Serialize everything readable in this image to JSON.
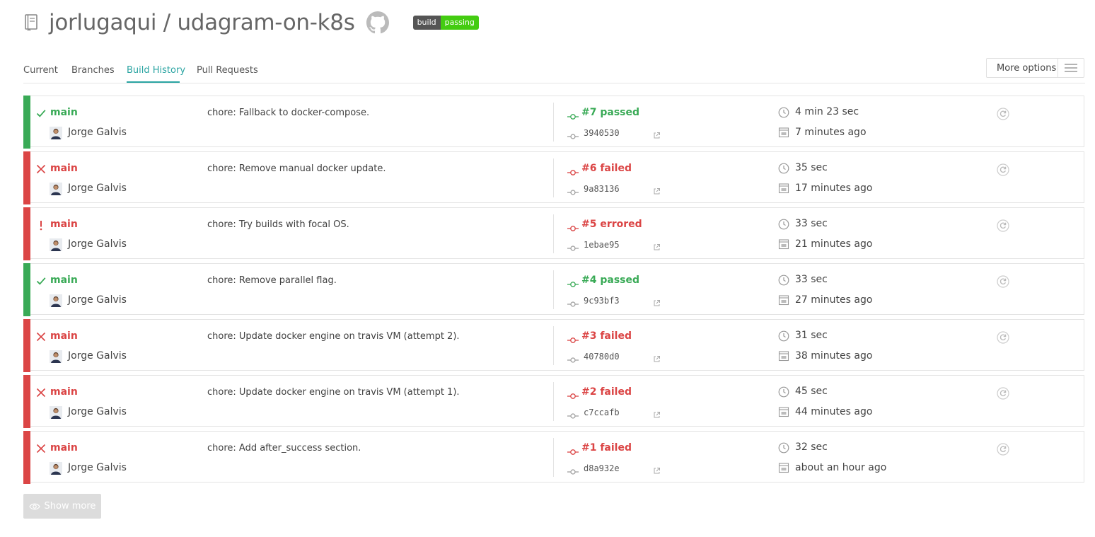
{
  "repo": {
    "title": "jorlugaqui / udagram-on-k8s",
    "badge_left": "build",
    "badge_right": "passing"
  },
  "tabs": [
    {
      "label": "Current"
    },
    {
      "label": "Branches"
    },
    {
      "label": "Build History",
      "active": true
    },
    {
      "label": "Pull Requests"
    }
  ],
  "more_options": {
    "label": "More options"
  },
  "colors": {
    "passed": "#39aa56",
    "failed": "#db4545",
    "accent": "#2aa4a2"
  },
  "builds": [
    {
      "state": "passed",
      "branch": "main",
      "author": "Jorge Galvis",
      "message": "chore: Fallback to docker-compose.",
      "number": "#7 passed",
      "sha": "3940530",
      "duration": "4 min 23 sec",
      "finished": "7 minutes ago"
    },
    {
      "state": "failed",
      "branch": "main",
      "author": "Jorge Galvis",
      "message": "chore: Remove manual docker update.",
      "number": "#6 failed",
      "sha": "9a83136",
      "duration": "35 sec",
      "finished": "17 minutes ago"
    },
    {
      "state": "errored",
      "branch": "main",
      "author": "Jorge Galvis",
      "message": "chore: Try builds with focal OS.",
      "number": "#5 errored",
      "sha": "1ebae95",
      "duration": "33 sec",
      "finished": "21 minutes ago"
    },
    {
      "state": "passed",
      "branch": "main",
      "author": "Jorge Galvis",
      "message": "chore: Remove parallel flag.",
      "number": "#4 passed",
      "sha": "9c93bf3",
      "duration": "33 sec",
      "finished": "27 minutes ago"
    },
    {
      "state": "failed",
      "branch": "main",
      "author": "Jorge Galvis",
      "message": "chore: Update docker engine on travis VM (attempt 2).",
      "number": "#3 failed",
      "sha": "40780d0",
      "duration": "31 sec",
      "finished": "38 minutes ago"
    },
    {
      "state": "failed",
      "branch": "main",
      "author": "Jorge Galvis",
      "message": "chore: Update docker engine on travis VM (attempt 1).",
      "number": "#2 failed",
      "sha": "c7ccafb",
      "duration": "45 sec",
      "finished": "44 minutes ago"
    },
    {
      "state": "failed",
      "branch": "main",
      "author": "Jorge Galvis",
      "message": "chore: Add after_success section.",
      "number": "#1 failed",
      "sha": "d8a932e",
      "duration": "32 sec",
      "finished": "about an hour ago"
    }
  ],
  "show_more": {
    "label": "Show more"
  }
}
